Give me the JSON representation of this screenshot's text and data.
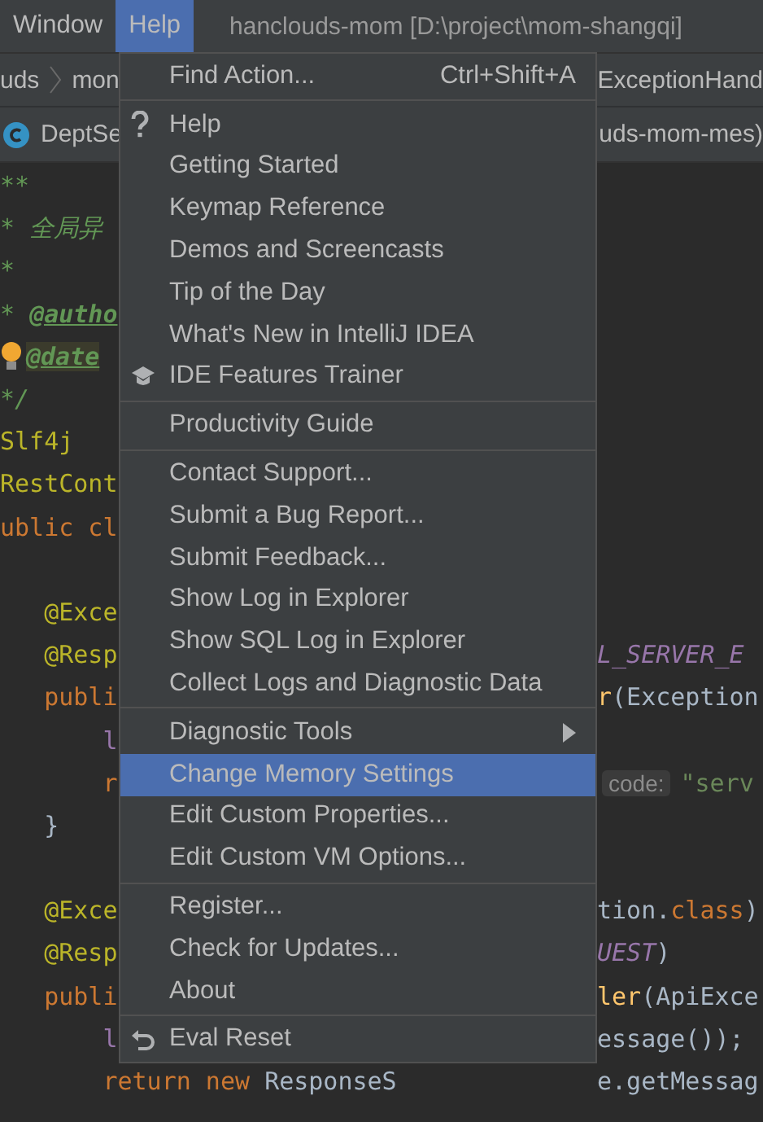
{
  "menu_bar": {
    "items": [
      {
        "label": "Window",
        "selected": false
      },
      {
        "label": "Help",
        "selected": true
      }
    ],
    "title": "hanclouds-mom [D:\\project\\mom-shangqi]"
  },
  "breadcrumbs": {
    "left": [
      "uds",
      "mon"
    ],
    "right": "ExceptionHand"
  },
  "tabs": {
    "left": "DeptSe",
    "right": "uds-mom-mes)"
  },
  "editor": {
    "lines": [
      {
        "left": [
          {
            "kind": "comment",
            "text": "**"
          }
        ]
      },
      {
        "left": [
          {
            "kind": "comment",
            "text": "* 全局异"
          }
        ]
      },
      {
        "left": [
          {
            "kind": "comment",
            "text": "*"
          }
        ]
      },
      {
        "left": [
          {
            "kind": "comment",
            "text": "* "
          },
          {
            "kind": "doc-tag",
            "text": "@autho"
          }
        ]
      },
      {
        "kind": "bulb",
        "left": [
          {
            "kind": "doc-tag-marked",
            "text": "@date"
          }
        ]
      },
      {
        "left": [
          {
            "kind": "comment",
            "text": "*/"
          }
        ]
      },
      {
        "left": [
          {
            "kind": "annotation",
            "text": "Slf4j"
          }
        ]
      },
      {
        "left": [
          {
            "kind": "annotation",
            "text": "RestCont"
          }
        ]
      },
      {
        "left": [
          {
            "kind": "keyword",
            "text": "ublic cl"
          }
        ]
      },
      {
        "blank_before": true,
        "left": [
          {
            "kind": "annotation",
            "text": "   @Exce"
          }
        ]
      },
      {
        "left": [
          {
            "kind": "annotation",
            "text": "   @Resp"
          }
        ],
        "right": [
          {
            "kind": "constant",
            "text": "L_SERVER_E"
          }
        ]
      },
      {
        "left": [
          {
            "kind": "keyword",
            "text": "   publi"
          }
        ],
        "right": [
          {
            "kind": "method",
            "text": "r"
          },
          {
            "kind": "plain",
            "text": "(Exception"
          }
        ]
      },
      {
        "left": [
          {
            "kind": "field",
            "text": "       l"
          }
        ]
      },
      {
        "left": [
          {
            "kind": "keyword",
            "text": "       r"
          }
        ],
        "right": [
          {
            "kind": "hint",
            "text": "code:"
          },
          {
            "kind": "string",
            "text": "\"serv"
          }
        ]
      },
      {
        "left": [
          {
            "kind": "plain",
            "text": "   }"
          }
        ]
      },
      {
        "blank_before": true,
        "left": [
          {
            "kind": "annotation",
            "text": "   @Exce"
          }
        ],
        "right": [
          {
            "kind": "plain",
            "text": "tion."
          },
          {
            "kind": "keyword",
            "text": "class"
          },
          {
            "kind": "plain",
            "text": ")"
          }
        ]
      },
      {
        "left": [
          {
            "kind": "annotation",
            "text": "   @Resp"
          }
        ],
        "right": [
          {
            "kind": "constant",
            "text": "UEST"
          },
          {
            "kind": "plain",
            "text": ")"
          }
        ]
      },
      {
        "left": [
          {
            "kind": "keyword",
            "text": "   publi"
          }
        ],
        "right": [
          {
            "kind": "method",
            "text": "ler"
          },
          {
            "kind": "plain",
            "text": "(ApiExce"
          }
        ]
      },
      {
        "left": [
          {
            "kind": "field",
            "text": "       l"
          }
        ],
        "right": [
          {
            "kind": "plain",
            "text": "essage());"
          }
        ]
      },
      {
        "left": [
          {
            "kind": "keyword",
            "text": "       return new "
          },
          {
            "kind": "plain",
            "text": "ResponseS"
          }
        ],
        "right": [
          {
            "kind": "plain",
            "text": "e.getMessag"
          }
        ]
      }
    ]
  },
  "menu": {
    "sections": [
      [
        {
          "kind": "plain",
          "label": "Find Action...",
          "shortcut": "Ctrl+Shift+A",
          "selected": false
        }
      ],
      [
        {
          "kind": "help",
          "label": "Help",
          "selected": false
        },
        {
          "kind": "plain",
          "label": "Getting Started",
          "selected": false
        },
        {
          "kind": "plain",
          "label": "Keymap Reference",
          "selected": false
        },
        {
          "kind": "plain",
          "label": "Demos and Screencasts",
          "selected": false
        },
        {
          "kind": "plain",
          "label": "Tip of the Day",
          "selected": false
        },
        {
          "kind": "plain",
          "label": "What's New in IntelliJ IDEA",
          "selected": false
        },
        {
          "kind": "trainer",
          "label": "IDE Features Trainer",
          "selected": false
        }
      ],
      [
        {
          "kind": "plain",
          "label": "Productivity Guide",
          "selected": false
        }
      ],
      [
        {
          "kind": "plain",
          "label": "Contact Support...",
          "selected": false
        },
        {
          "kind": "plain",
          "label": "Submit a Bug Report...",
          "selected": false
        },
        {
          "kind": "plain",
          "label": "Submit Feedback...",
          "selected": false
        },
        {
          "kind": "plain",
          "label": "Show Log in Explorer",
          "selected": false
        },
        {
          "kind": "plain",
          "label": "Show SQL Log in Explorer",
          "selected": false
        },
        {
          "kind": "plain",
          "label": "Collect Logs and Diagnostic Data",
          "selected": false
        }
      ],
      [
        {
          "kind": "submenu",
          "label": "Diagnostic Tools",
          "selected": false
        },
        {
          "kind": "plain",
          "label": "Change Memory Settings",
          "selected": true
        },
        {
          "kind": "plain",
          "label": "Edit Custom Properties...",
          "selected": false
        },
        {
          "kind": "plain",
          "label": "Edit Custom VM Options...",
          "selected": false
        }
      ],
      [
        {
          "kind": "plain",
          "label": "Register...",
          "selected": false
        },
        {
          "kind": "plain",
          "label": "Check for Updates...",
          "selected": false
        },
        {
          "kind": "plain",
          "label": "About",
          "selected": false
        }
      ],
      [
        {
          "kind": "reset",
          "label": "Eval Reset",
          "selected": false
        }
      ]
    ]
  }
}
